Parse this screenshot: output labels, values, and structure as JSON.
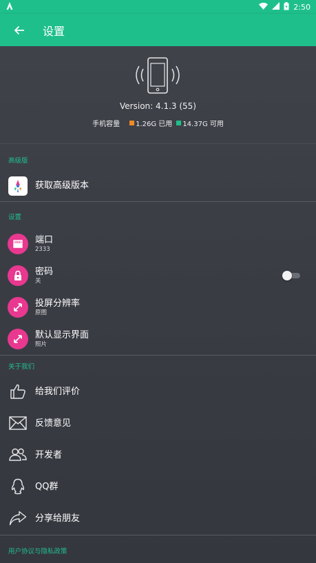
{
  "status_bar": {
    "time": "2:50"
  },
  "app_bar": {
    "title": "设置"
  },
  "header": {
    "version": "Version: 4.1.3 (55)",
    "storage_label": "手机容量",
    "used": "1.26G 已用",
    "free": "14.37G 可用",
    "used_color": "#f08a24",
    "free_color": "#1fbf8c"
  },
  "premium_section": {
    "label": "高级版",
    "items": [
      {
        "title": "获取高级版本",
        "icon": "premium-app-icon"
      }
    ]
  },
  "settings_section": {
    "label": "设置",
    "items": [
      {
        "title": "端口",
        "subtitle": "2333",
        "icon": "ethernet-port-icon"
      },
      {
        "title": "密码",
        "subtitle": "关",
        "icon": "lock-icon",
        "toggle": false
      },
      {
        "title": "投屏分辨率",
        "subtitle": "原图",
        "icon": "expand-arrows-icon"
      },
      {
        "title": "默认显示界面",
        "subtitle": "照片",
        "icon": "expand-arrows-icon"
      }
    ]
  },
  "about_section": {
    "label": "关于我们",
    "items": [
      {
        "title": "给我们评价",
        "icon": "thumbs-up-icon"
      },
      {
        "title": "反馈意见",
        "icon": "envelope-icon"
      },
      {
        "title": "开发者",
        "icon": "people-icon"
      },
      {
        "title": "QQ群",
        "icon": "qq-penguin-icon"
      },
      {
        "title": "分享给朋友",
        "icon": "share-arrow-icon"
      }
    ]
  },
  "policy_section": {
    "label": "用户协议与隐私政策"
  },
  "colors": {
    "accent": "#1fbf8c",
    "pink": "#e8388f",
    "background": "#3a3c44"
  }
}
